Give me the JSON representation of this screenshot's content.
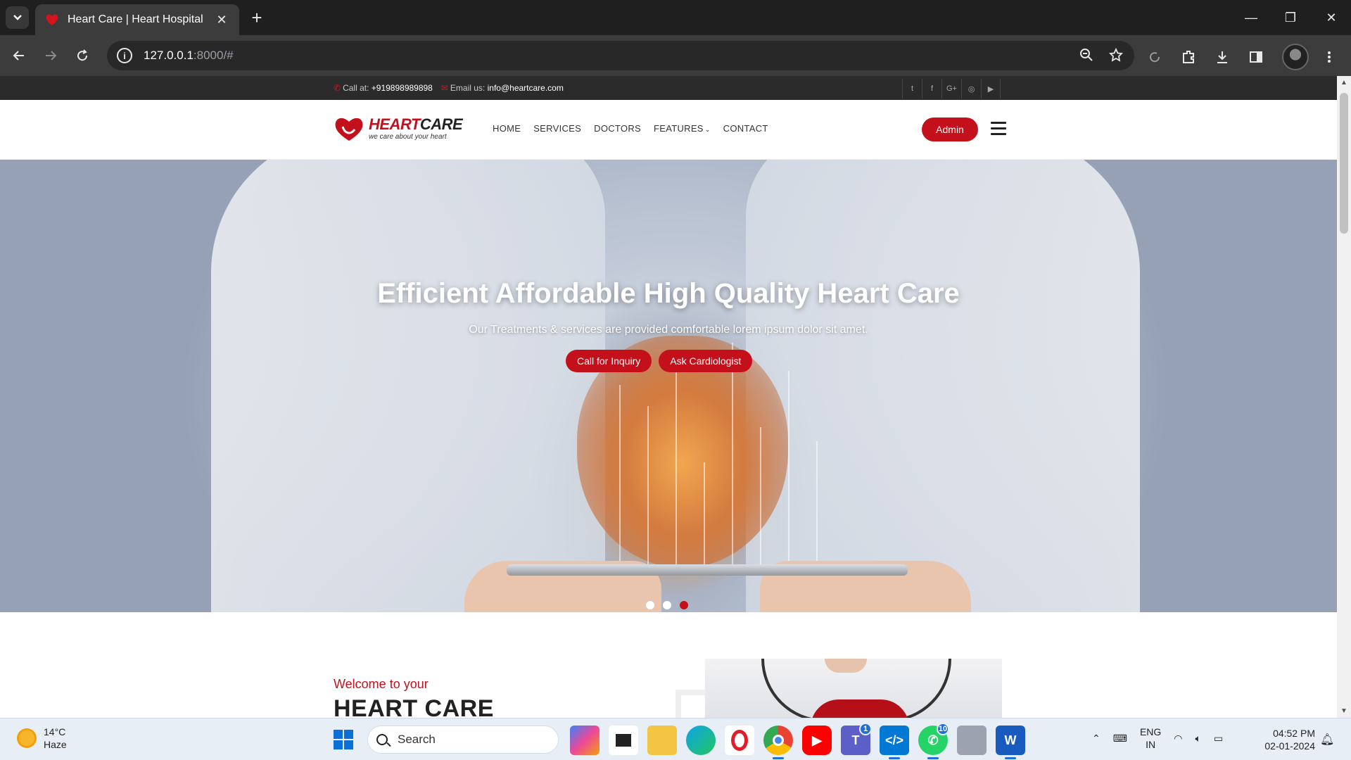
{
  "browser": {
    "tab_title": "Heart Care | Heart Hospital",
    "url_host": "127.0.0.1",
    "url_path": ":8000/#"
  },
  "topbar": {
    "call_label": "Call at:",
    "call_number": "+919898989898",
    "email_label": "Email us:",
    "email": "info@heartcare.com",
    "socials": [
      "twitter-icon",
      "facebook-icon",
      "google-plus-icon",
      "instagram-icon",
      "youtube-icon"
    ]
  },
  "logo": {
    "name_red": "HEART",
    "name_dark": "CARE",
    "tagline": "we care about your heart"
  },
  "nav": {
    "items": [
      "HOME",
      "SERVICES",
      "DOCTORS",
      "FEATURES",
      "CONTACT"
    ],
    "admin_label": "Admin"
  },
  "hero": {
    "title": "Efficient Affordable High Quality Heart Care",
    "subtitle": "Our Treatments & services are provided comfortable lorem ipsum dolor sit amet.",
    "button_primary": "Call for Inquiry",
    "button_secondary": "Ask Cardiologist",
    "slides_count": 3,
    "active_slide": 3
  },
  "about": {
    "welcome": "Welcome to your",
    "title": "HEART CARE"
  },
  "taskbar": {
    "temperature": "14°C",
    "weather": "Haze",
    "search_placeholder": "Search",
    "teams_badge": "1",
    "whatsapp_badge": "10",
    "lang_top": "ENG",
    "lang_bottom": "IN",
    "time": "04:52 PM",
    "date": "02-01-2024"
  },
  "colors": {
    "brand_red": "#c4101b",
    "chrome_dark": "#1f1f1f",
    "topbar_bg": "#2b2b2b"
  }
}
